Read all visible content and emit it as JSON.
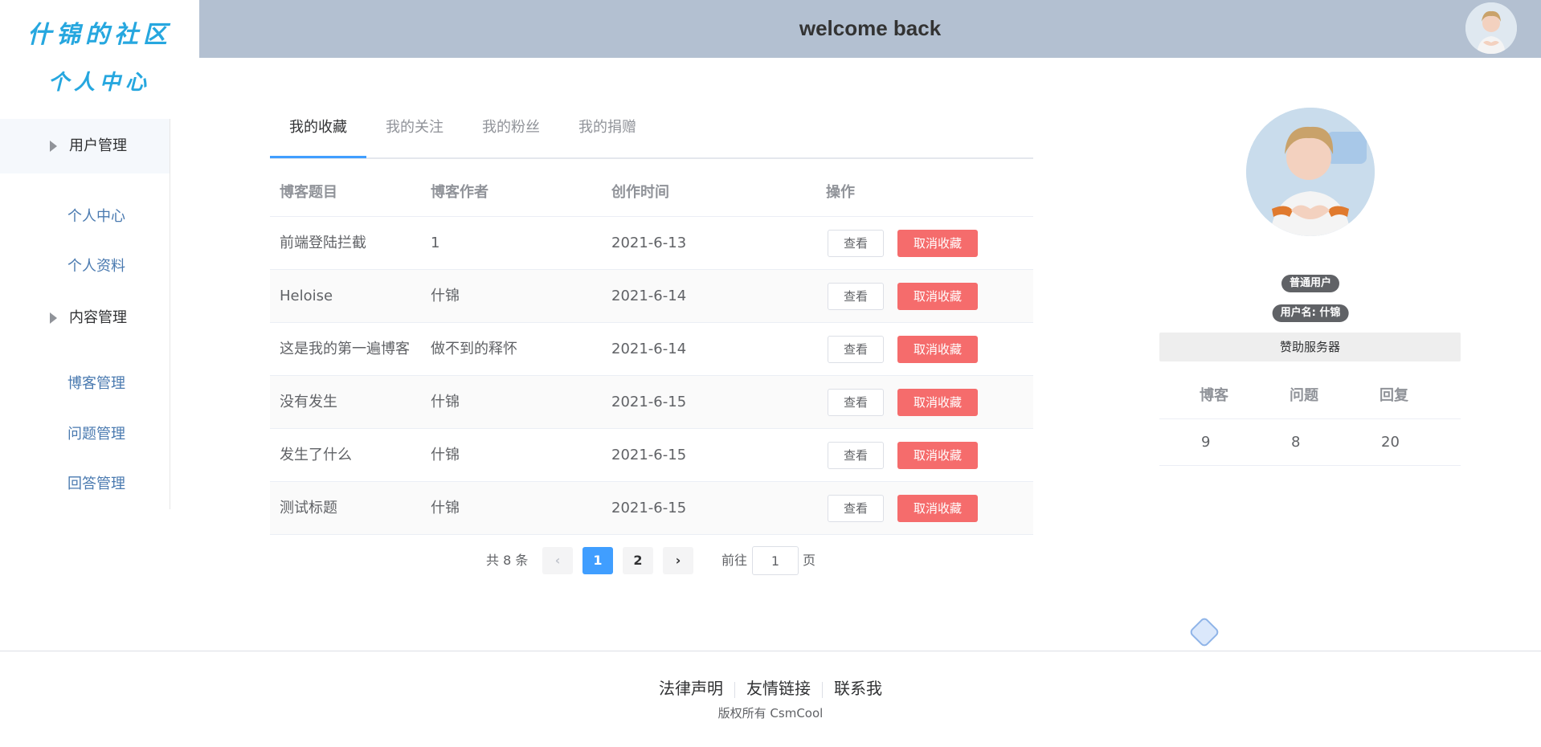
{
  "header": {
    "title": "welcome back"
  },
  "logo": {
    "title": "什锦的社区",
    "subtitle": "个人中心"
  },
  "sidebar": {
    "groups": [
      {
        "label": "用户管理",
        "items": [
          "个人中心",
          "个人资料"
        ]
      },
      {
        "label": "内容管理",
        "items": [
          "博客管理",
          "问题管理",
          "回答管理"
        ]
      }
    ]
  },
  "tabs": [
    {
      "label": "我的收藏",
      "active": true
    },
    {
      "label": "我的关注"
    },
    {
      "label": "我的粉丝"
    },
    {
      "label": "我的捐赠"
    }
  ],
  "table": {
    "columns": [
      "博客题目",
      "博客作者",
      "创作时间",
      "操作"
    ],
    "rows": [
      {
        "title": "前端登陆拦截",
        "author": "1",
        "date": "2021-6-13"
      },
      {
        "title": "Heloise",
        "author": "什锦",
        "date": "2021-6-14"
      },
      {
        "title": "这是我的第一遍博客",
        "author": "做不到的释怀",
        "date": "2021-6-14"
      },
      {
        "title": "没有发生",
        "author": "什锦",
        "date": "2021-6-15"
      },
      {
        "title": "发生了什么",
        "author": "什锦",
        "date": "2021-6-15"
      },
      {
        "title": "测试标题",
        "author": "什锦",
        "date": "2021-6-15"
      }
    ],
    "view_label": "查看",
    "cancel_label": "取消收藏"
  },
  "pagination": {
    "total_text": "共 8 条",
    "prev": "‹",
    "next": "›",
    "pages": [
      "1",
      "2"
    ],
    "current_page": "1",
    "goto_label": "前往",
    "goto_value": "1",
    "page_unit": "页"
  },
  "profile": {
    "role_badge": "普通用户",
    "username_badge": "用户名: 什锦",
    "sponsor_label": "赞助服务器",
    "stats_headers": [
      "博客",
      "问题",
      "回复"
    ],
    "stats_values": [
      "9",
      "8",
      "20"
    ]
  },
  "footer": {
    "links": [
      "法律声明",
      "友情链接",
      "联系我"
    ],
    "copyright": "版权所有 CsmCool"
  },
  "colors": {
    "primary": "#409eff",
    "danger": "#f56c6c",
    "header_bg": "#b3c0d1",
    "logo": "#26a7df"
  }
}
